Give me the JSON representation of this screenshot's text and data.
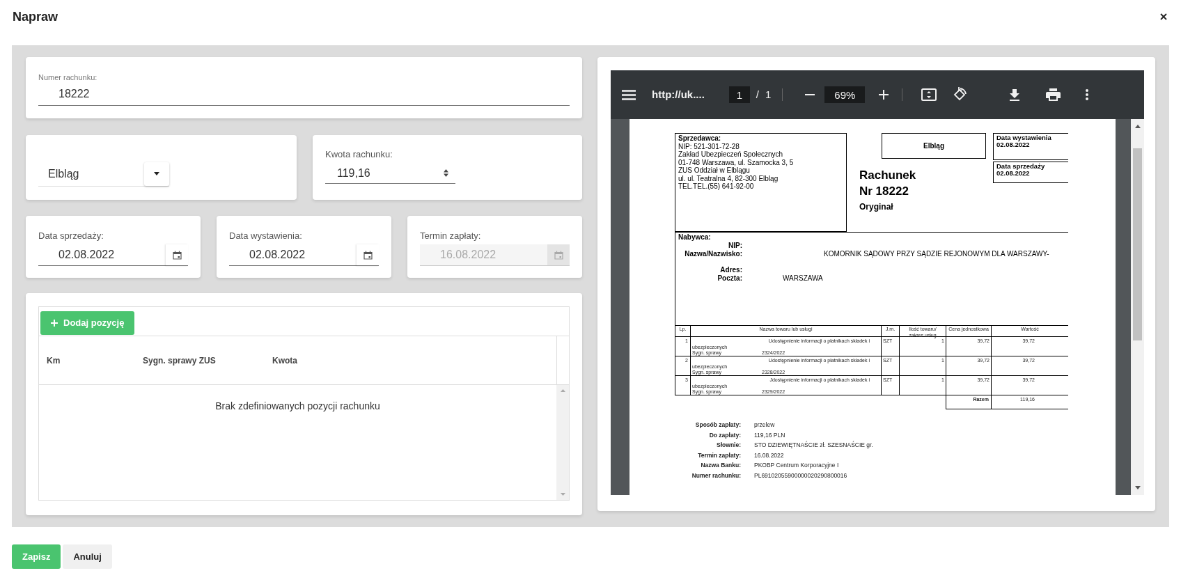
{
  "dialog": {
    "title": "Napraw"
  },
  "invoice_number": {
    "label": "Numer rachunku:",
    "value": "18222"
  },
  "branch_select": {
    "value": "Elbląg"
  },
  "amount": {
    "label": "Kwota rachunku:",
    "value": "119,16"
  },
  "date_fields": [
    {
      "label": "Data sprzedaży:",
      "value": "02.08.2022",
      "disabled": false
    },
    {
      "label": "Data wystawienia:",
      "value": "02.08.2022",
      "disabled": false
    },
    {
      "label": "Termin zapłaty:",
      "value": "16.08.2022",
      "disabled": true
    }
  ],
  "items": {
    "add_button": "Dodaj pozycję",
    "columns": [
      "Km",
      "Sygn. sprawy ZUS",
      "Kwota"
    ],
    "empty_message": "Brak zdefiniowanych pozycji rachunku"
  },
  "pdf_viewer": {
    "toolbar": {
      "url": "http://uk....",
      "page": "1",
      "separator": "/",
      "page_count": "1",
      "zoom": "69%"
    },
    "document": {
      "seller": {
        "heading": "Sprzedawca:",
        "lines": [
          "NIP: 521-301-72-28",
          "Zakład Ubezpieczeń Społecznych",
          "01-748 Warszawa, ul. Szamocka 3, 5",
          "ZUS Oddział w Elblągu",
          "ul. ul. Teatralna 4, 82-300 Elbląg",
          "TEL.TEL.(55) 641-92-00"
        ]
      },
      "city": "Elbląg",
      "title": "Rachunek",
      "number": "Nr 18222",
      "copy": "Oryginał",
      "dates": [
        {
          "label": "Data wystawienia",
          "value": "02.08.2022"
        },
        {
          "label": "Data sprzedaży",
          "value": "02.08.2022"
        }
      ],
      "buyer": {
        "heading": "Nabywca:",
        "fields": [
          {
            "label": "NIP:"
          },
          {
            "label": "Nazwa/Nazwisko:",
            "value": "KOMORNIK SĄDOWY PRZY SĄDZIE REJONOWYM DLA WARSZAWY-"
          },
          {
            "label": "Adres:"
          },
          {
            "label": "Poczta:",
            "value": "WARSZAWA"
          }
        ]
      },
      "table": {
        "columns": [
          "Lp.",
          "Nazwa towaru lub usługi",
          "J.m.",
          "Ilość towaru/\nzakres usług",
          "Cena jednostkowa",
          "Wartość"
        ],
        "rows": [
          {
            "lp": "1",
            "description": "Udostępnienie informacji o płatnikach składek i",
            "description_2": "ubezpieczonych",
            "case_label": "Sygn. sprawy",
            "case_number": "2324/2022",
            "unit": "SZT",
            "quantity": "1",
            "unit_price": "39,72",
            "value": "39,72"
          },
          {
            "lp": "2",
            "description": "Udostępnienie informacji o płatnikach składek i",
            "description_2": "ubezpieczonych",
            "case_label": "Sygn. sprawy",
            "case_number": "2328/2022",
            "unit": "SZT",
            "quantity": "1",
            "unit_price": "39,72",
            "value": "39,72"
          },
          {
            "lp": "3",
            "description": "Jdostępnienie informacji o płatnikach składek i",
            "description_2": "ubezpieczonych",
            "case_label": "Sygn. sprawy",
            "case_number": "2329/2022",
            "unit": "SZT",
            "quantity": "1",
            "unit_price": "39,72",
            "value": "39,72"
          }
        ],
        "total": {
          "label": "Razem",
          "value": "119,16"
        }
      },
      "payment": [
        {
          "label": "Sposób zapłaty:",
          "value": "przelew"
        },
        {
          "label": "Do zapłaty:",
          "value": "119,16 PLN"
        },
        {
          "label": "Słownie:",
          "value": "STO DZIEWIĘTNAŚCIE zł. SZESNAŚCIE gr."
        },
        {
          "label": "Termin zapłaty:",
          "value": "16.08.2022"
        },
        {
          "label": "Nazwa Banku:",
          "value": "PKOBP Centrum Korporacyjne I"
        },
        {
          "label": "Numer rachunku:",
          "value": "PL69102055900000020290800016"
        }
      ]
    }
  },
  "buttons": [
    {
      "label": "Zapisz",
      "kind": "primary"
    },
    {
      "label": "Anuluj",
      "kind": "secondary"
    }
  ]
}
